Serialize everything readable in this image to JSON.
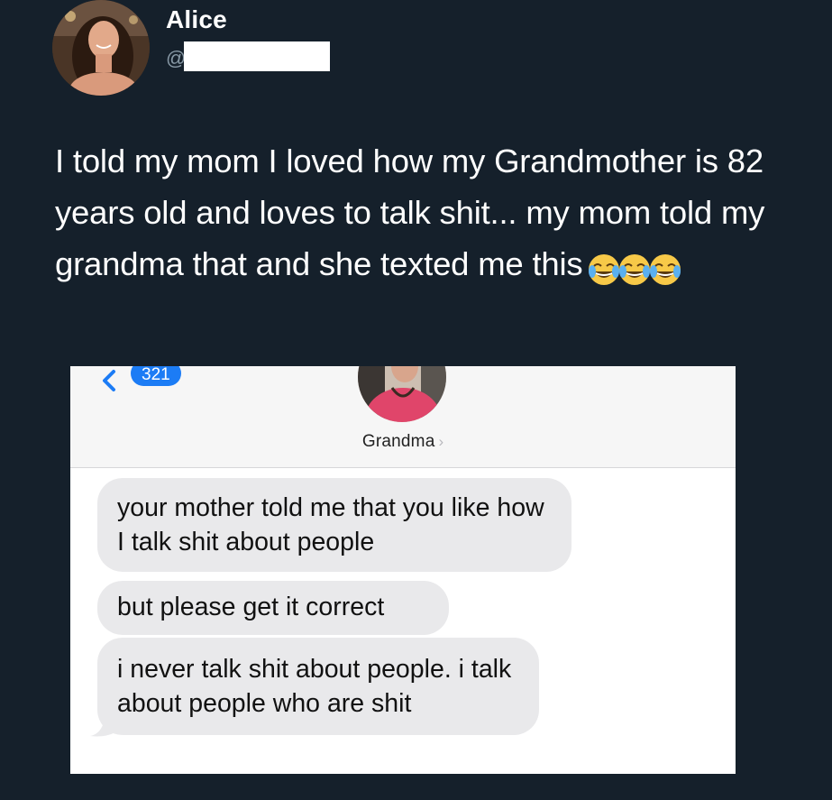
{
  "tweet": {
    "display_name": "Alice",
    "handle_prefix": "@",
    "text": "I told my mom I loved how my Grandmother is 82 years old and loves to talk shit... my mom told my grandma that and she texted me this",
    "emoji": [
      "face-with-tears-of-joy",
      "face-with-tears-of-joy",
      "face-with-tears-of-joy"
    ]
  },
  "imessage": {
    "back_count": "321",
    "contact_name": "Grandma",
    "messages": [
      "your mother told me that you like how I talk shit about people",
      "but please get it correct",
      "i never talk shit about people. i talk about people who are shit"
    ],
    "bubble_color": "#e9e9eb",
    "badge_color": "#1c7cf5"
  },
  "colors": {
    "background": "#15202b",
    "text": "#ffffff",
    "handle": "#8899a6"
  }
}
